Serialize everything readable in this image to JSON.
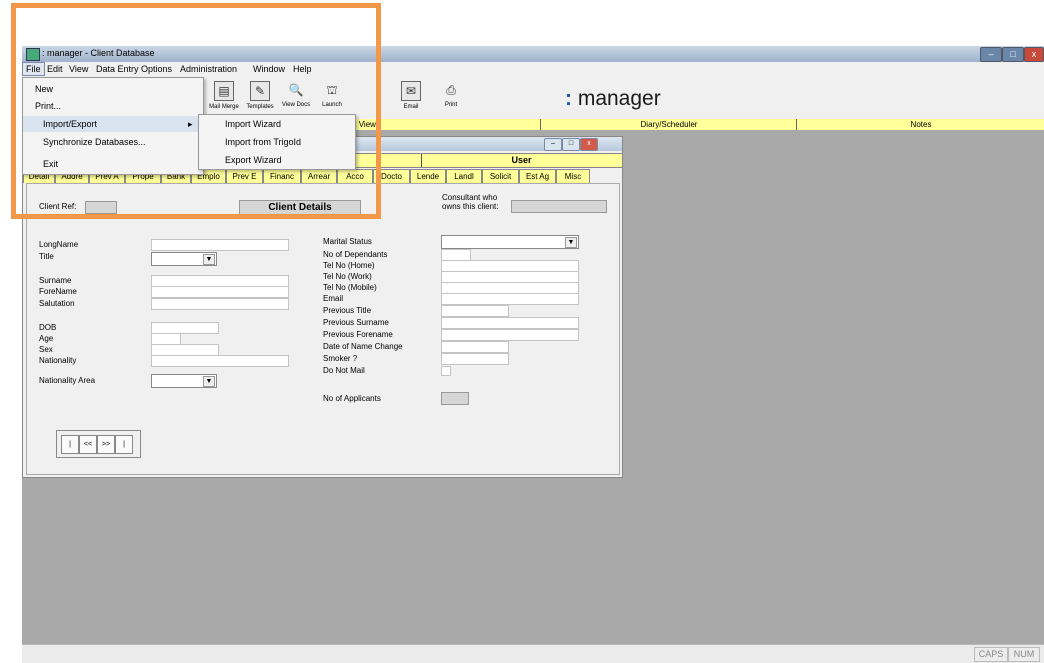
{
  "window": {
    "title": ": manager - Client Database"
  },
  "menubar": {
    "items": [
      "File",
      "Edit",
      "View",
      "Data Entry Options",
      "Administration",
      "Window",
      "Help"
    ]
  },
  "toolbar": {
    "buttons": [
      "Mail Merge",
      "Templates",
      "View Docs",
      "Launch",
      "Email",
      "Print"
    ]
  },
  "brand": {
    "dot": ":",
    "name": " manager"
  },
  "main_tabs": [
    "List View",
    "Diary/Scheduler",
    "Notes"
  ],
  "file_menu": {
    "items": [
      "New",
      "Print...",
      "Import/Export",
      "Synchronize Databases...",
      "Exit"
    ],
    "submenu_arrow": "▸",
    "submenu": [
      "Import Wizard",
      "Import from TrigoId",
      "Export Wizard"
    ]
  },
  "child": {
    "header_right": "User",
    "tabs": [
      "Detail",
      "Addre",
      "Prev A",
      "Prope",
      "Bank",
      "Emplo",
      "Prev E",
      "Financ",
      "Arrear",
      "Acco",
      "Docto",
      "Lende",
      "Landl",
      "Solicit",
      "Est Ag",
      "Misc"
    ],
    "client_ref_label": "Client Ref:",
    "section_title": "Client Details",
    "consultant_label_1": "Consultant who",
    "consultant_label_2": "owns this client:",
    "left_fields": [
      "LongName",
      "Title",
      "Surname",
      "ForeName",
      "Salutation",
      "DOB",
      "Age",
      "Sex",
      "Nationality",
      "Nationality Area"
    ],
    "right_fields": [
      "Marital Status",
      "No of Dependants",
      "Tel No (Home)",
      "Tel No (Work)",
      "Tel No (Mobile)",
      "Email",
      "Previous Title",
      "Previous Surname",
      "Previous Forename",
      "Date of Name Change",
      "Smoker ?",
      "Do Not Mail",
      "No of Applicants"
    ],
    "nav": [
      "|",
      "<<",
      ">>",
      "|"
    ]
  },
  "statusbar": {
    "caps": "CAPS",
    "num": "NUM"
  },
  "colors": {
    "highlight": "#f29848",
    "tab_yellow": "#ffff99",
    "mdi_bg": "#a9a9a9"
  }
}
